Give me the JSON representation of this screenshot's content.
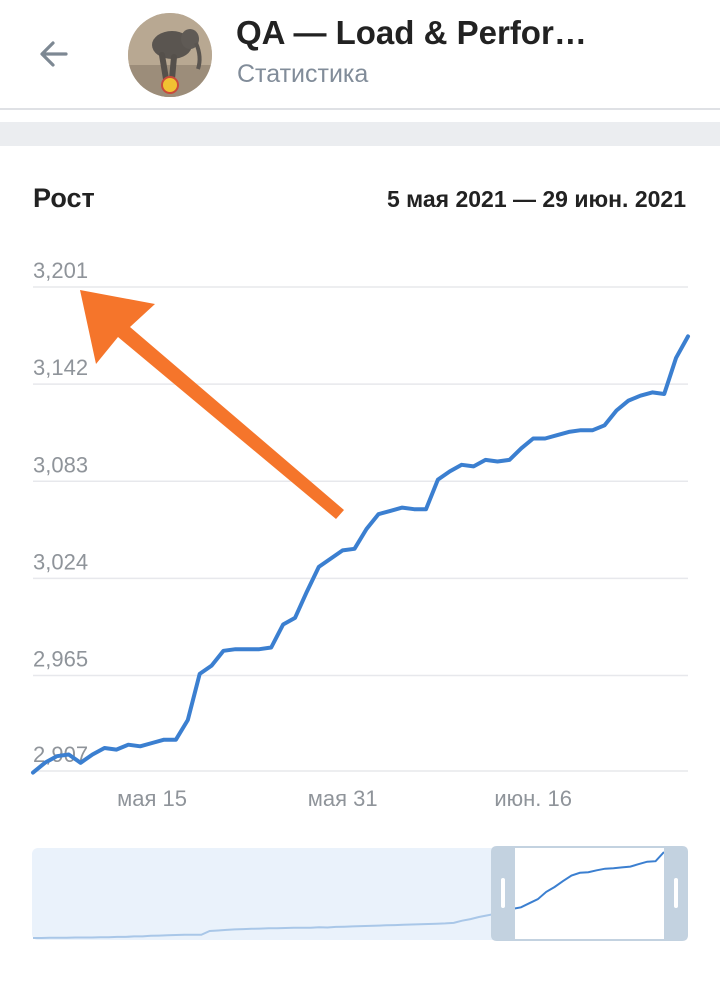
{
  "header": {
    "title": "QA — Load & Performance",
    "subtitle": "Статистика",
    "back_icon": "arrow-left-icon",
    "avatar": "elephant-on-ball-avatar"
  },
  "card": {
    "title": "Рост",
    "date_range": "5 мая 2021 — 29 июн. 2021"
  },
  "colors": {
    "line": "#3b7fd0",
    "annotation_arrow": "#f5752b",
    "minimap_bg": "#eaf2fb",
    "minimap_handle": "#c3d2e0"
  },
  "chart_data": {
    "type": "line",
    "ylim": [
      2907,
      3201
    ],
    "y_ticks": [
      "3,201",
      "3,142",
      "3,083",
      "3,024",
      "2,965",
      "2,907"
    ],
    "y_tick_values": [
      3201,
      3142,
      3083,
      3024,
      2965,
      2907
    ],
    "x_ticks": [
      "мая 15",
      "мая 31",
      "июн. 16"
    ],
    "x_tick_days": [
      10,
      26,
      42
    ],
    "grid": true,
    "series": [
      {
        "x": [
          0,
          1,
          2,
          3,
          4,
          5,
          6,
          7,
          8,
          9,
          10,
          11,
          12,
          13,
          14,
          15,
          16,
          17,
          18,
          19,
          20,
          21,
          22,
          23,
          24,
          25,
          26,
          27,
          28,
          29,
          30,
          31,
          32,
          33,
          34,
          35,
          36,
          37,
          38,
          39,
          40,
          41,
          42,
          43,
          44,
          45,
          46,
          47,
          48,
          49,
          50,
          51,
          52,
          53,
          54,
          55
        ],
        "values": [
          2906,
          2912,
          2916,
          2917,
          2912,
          2917,
          2921,
          2920,
          2923,
          2922,
          2924,
          2926,
          2926,
          2938,
          2966,
          2971,
          2980,
          2981,
          2981,
          2981,
          2982,
          2996,
          3000,
          3016,
          3031,
          3036,
          3041,
          3042,
          3054,
          3063,
          3065,
          3067,
          3066,
          3066,
          3084,
          3089,
          3093,
          3092,
          3096,
          3095,
          3096,
          3103,
          3109,
          3109,
          3111,
          3113,
          3114,
          3114,
          3117,
          3126,
          3132,
          3135,
          3137,
          3136,
          3158,
          3171
        ]
      }
    ],
    "annotation": "orange arrow pointing to 3,201"
  },
  "minimap": {
    "left_handle": "left-range-handle",
    "right_handle": "right-range-handle",
    "values": [
      2852,
      2852,
      2853,
      2853,
      2853,
      2854,
      2854,
      2854,
      2855,
      2855,
      2856,
      2856,
      2858,
      2858,
      2860,
      2861,
      2862,
      2863,
      2864,
      2864,
      2864,
      2878,
      2880,
      2882,
      2884,
      2885,
      2886,
      2887,
      2888,
      2888,
      2889,
      2890,
      2890,
      2890,
      2892,
      2891,
      2893,
      2894,
      2895,
      2896,
      2897,
      2898,
      2899,
      2900,
      2901,
      2902,
      2903,
      2904,
      2905,
      2906,
      2908,
      2916,
      2922,
      2930,
      2936,
      2942,
      2950,
      2960,
      2966,
      2981,
      2996,
      3023,
      3041,
      3063,
      3084,
      3094,
      3096,
      3103,
      3109,
      3111,
      3114,
      3117,
      3126,
      3135,
      3137,
      3171
    ]
  }
}
